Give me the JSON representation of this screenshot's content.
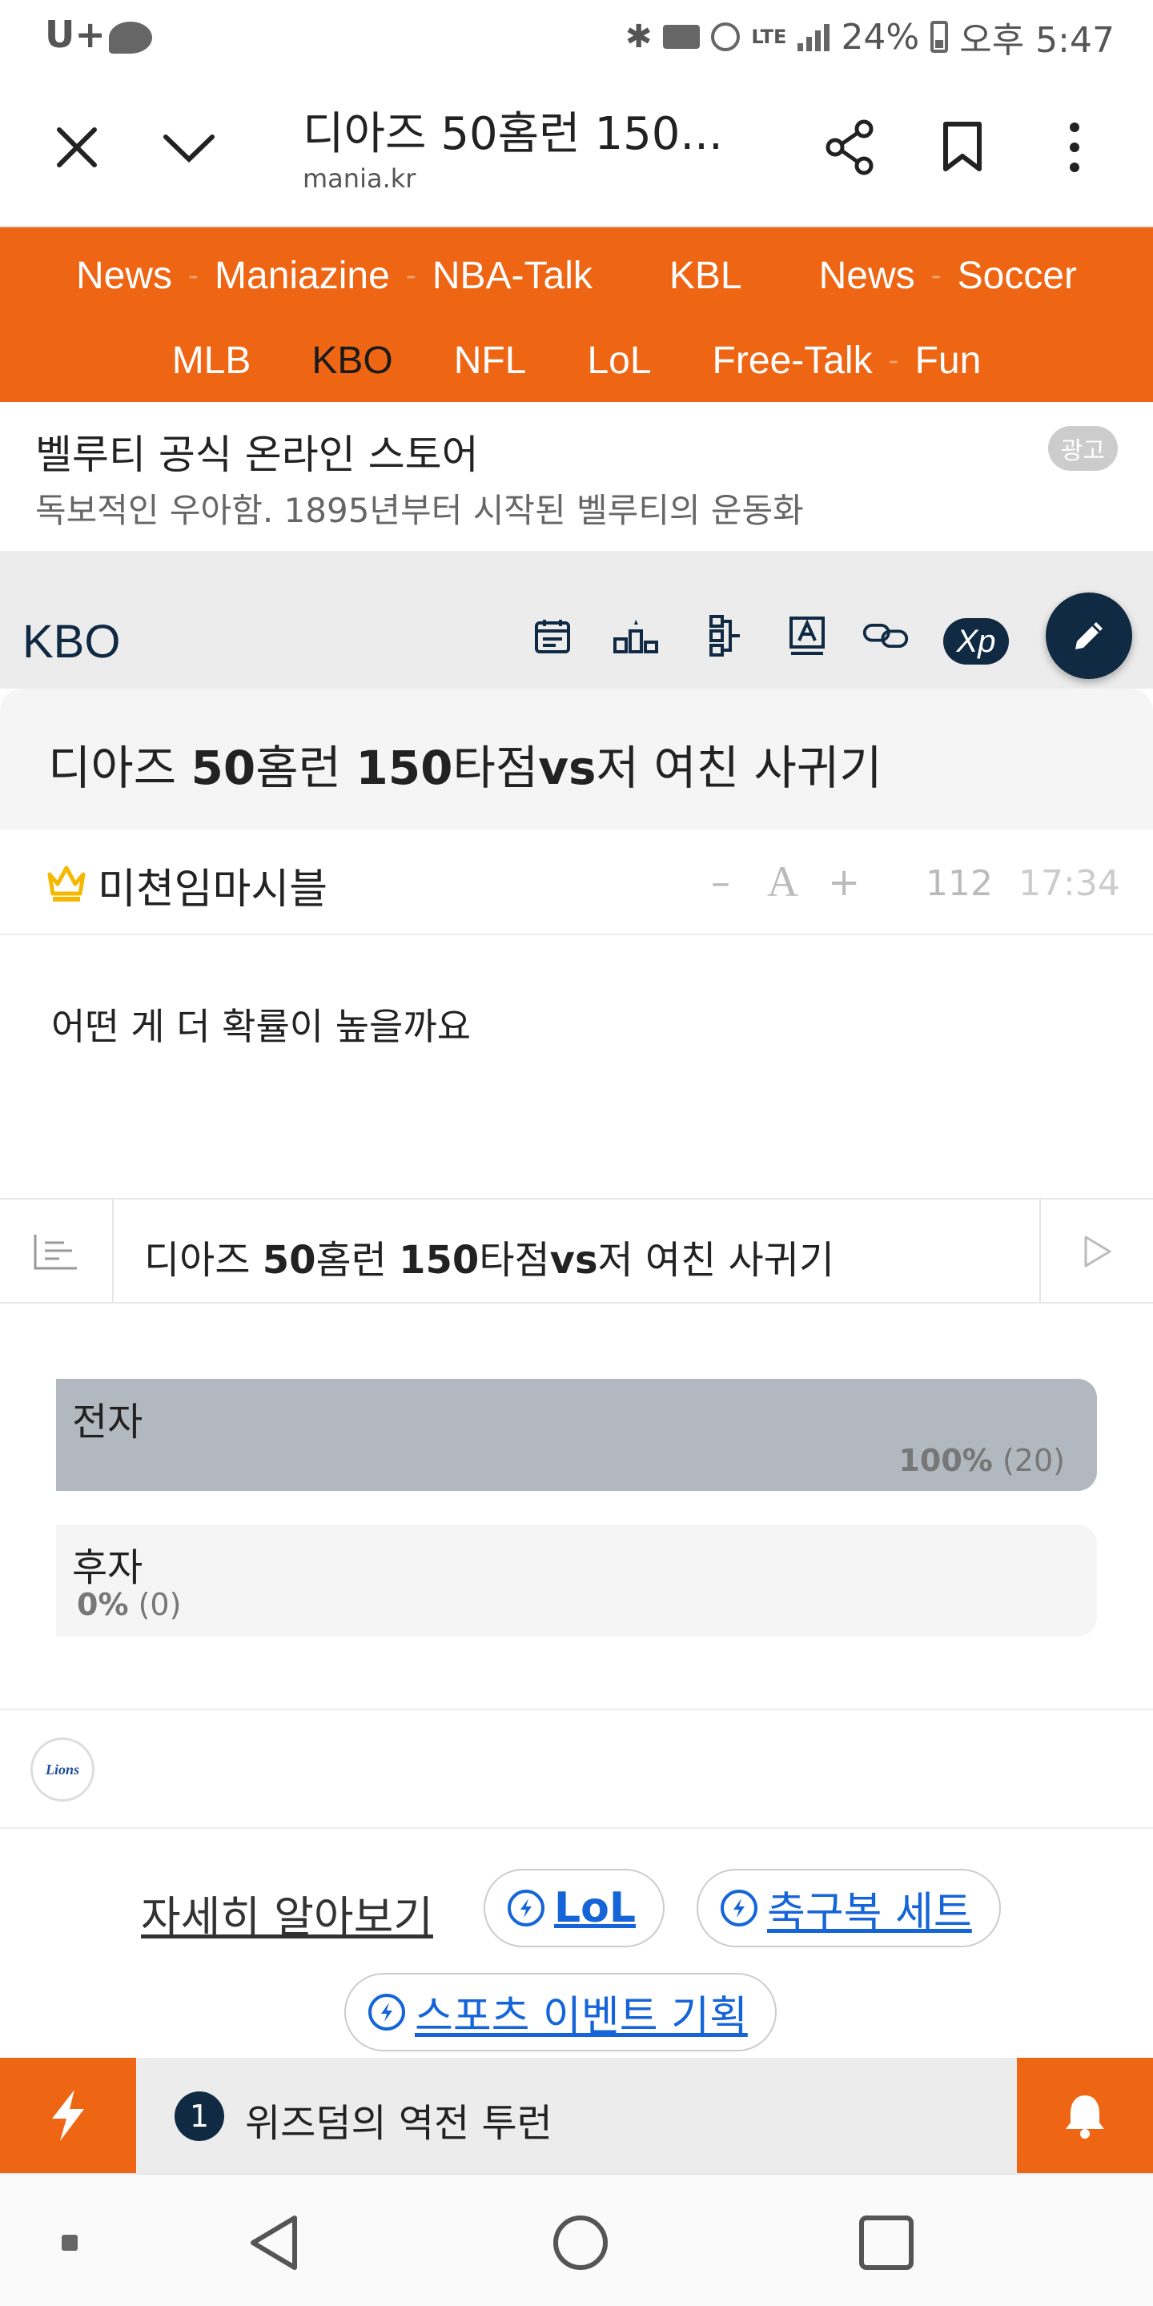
{
  "status_bar": {
    "carrier": "U+",
    "battery": "24%",
    "time": "오후 5:47"
  },
  "browser": {
    "title": "디아즈 50홈런 150...",
    "url": "mania.kr"
  },
  "nav": {
    "row1": [
      "News",
      "Maniazine",
      "NBA-Talk",
      "KBL",
      "News",
      "Soccer"
    ],
    "row2": [
      "MLB",
      "KBO",
      "NFL",
      "LoL",
      "Free-Talk",
      "Fun"
    ],
    "active": "KBO"
  },
  "ad": {
    "title": "벨루티 공식 온라인 스토어",
    "description": "독보적인 우아함. 1895년부터 시작된 벨루티의 운동화",
    "badge": "광고"
  },
  "board": {
    "name": "KBO",
    "xp_label": "Xp"
  },
  "post": {
    "title_parts": [
      "디아즈 ",
      "50",
      "홈런 ",
      "150",
      "타점",
      "vs",
      "저 여친 사귀기"
    ],
    "author": "미쳔임마시블",
    "font_minus": "–",
    "font_a": "A",
    "font_plus": "+",
    "views": "112",
    "time": "17:34",
    "body": "어떤 게 더 확률이 높을까요"
  },
  "poll": {
    "title_parts": [
      "디아즈 ",
      "50",
      "홈런 ",
      "150",
      "타점",
      "vs",
      "저 여친 사귀기"
    ],
    "options": [
      {
        "label": "전자",
        "percent": "100%",
        "count": "(20)",
        "fraction": 1.0
      },
      {
        "label": "후자",
        "percent": "0%",
        "count": "(0)",
        "fraction": 0.0
      }
    ]
  },
  "team_logo_text": "Lions",
  "promo": {
    "learn_more": "자세히 알아보기",
    "chips": [
      "LoL",
      "축구복 세트",
      "스포츠 이벤트 기획"
    ]
  },
  "ticker": {
    "rank": "1",
    "text": "위즈덤의 역전 투런"
  },
  "colors": {
    "accent": "#ee6514",
    "navy": "#102a43",
    "link": "#1565d8",
    "poll_fill": "#b2b8c0"
  }
}
